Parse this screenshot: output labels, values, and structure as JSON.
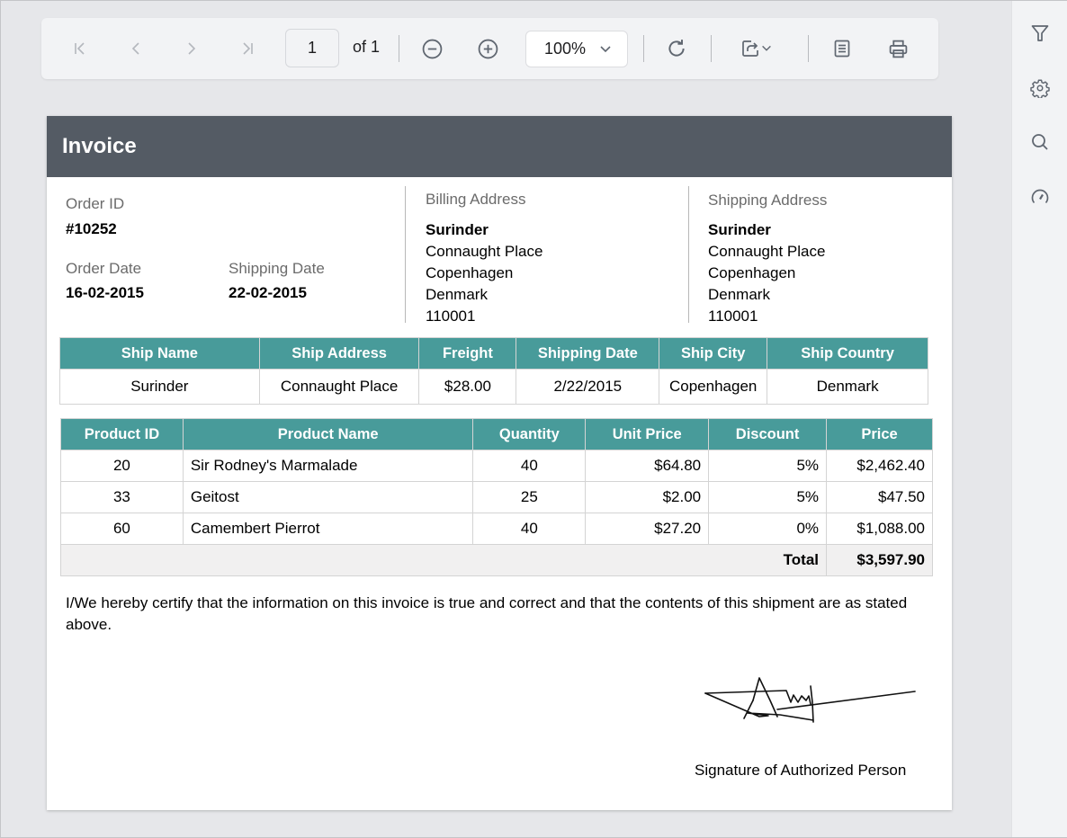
{
  "toolbar": {
    "buttons": {
      "first_page": "first-page-icon",
      "prev_page": "previous-page-icon",
      "next_page": "next-page-icon",
      "last_page": "last-page-icon",
      "zoom_out": "zoom-out-icon",
      "zoom_in": "zoom-in-icon",
      "refresh": "refresh-icon",
      "export": "export-icon",
      "parameters": "document-icon",
      "print": "print-icon"
    },
    "current_page": "1",
    "page_of": "of 1",
    "zoom_level": "100%"
  },
  "side_panel": {
    "items": [
      "filter-icon",
      "settings-icon",
      "search-icon",
      "performance-icon"
    ]
  },
  "invoice": {
    "title": "Invoice",
    "order_id_label": "Order ID",
    "order_id": "#10252",
    "order_date_label": "Order Date",
    "order_date": "16-02-2015",
    "shipping_date_label": "Shipping Date",
    "shipping_date": "22-02-2015",
    "billing": {
      "label": "Billing Address",
      "name": "Surinder",
      "street": "Connaught Place",
      "city": "Copenhagen",
      "country": "Denmark",
      "postal": "110001"
    },
    "shipping": {
      "label": "Shipping Address",
      "name": "Surinder",
      "street": "Connaught Place",
      "city": "Copenhagen",
      "country": "Denmark",
      "postal": "110001"
    },
    "ship_table": {
      "headers": [
        "Ship Name",
        "Ship Address",
        "Freight",
        "Shipping Date",
        "Ship City",
        "Ship Country"
      ],
      "row": [
        "Surinder",
        "Connaught Place",
        "$28.00",
        "2/22/2015",
        "Copenhagen",
        "Denmark"
      ]
    },
    "product_table": {
      "headers": [
        "Product ID",
        "Product Name",
        "Quantity",
        "Unit Price",
        "Discount",
        "Price"
      ],
      "rows": [
        [
          "20",
          "Sir Rodney's Marmalade",
          "40",
          "$64.80",
          "5%",
          "$2,462.40"
        ],
        [
          "33",
          "Geitost",
          "25",
          "$2.00",
          "5%",
          "$47.50"
        ],
        [
          "60",
          "Camembert Pierrot",
          "40",
          "$27.20",
          "0%",
          "$1,088.00"
        ]
      ],
      "total_label": "Total",
      "total_value": "$3,597.90"
    },
    "certification": "I/We hereby certify that the information on this invoice is true and correct and that the contents of this shipment are as stated above.",
    "signature_label": "Signature of Authorized Person"
  },
  "colors": {
    "header_bg": "#545b64",
    "table_header_bg": "#489b9a",
    "total_row_bg": "#f1f0f0",
    "viewer_bg": "#e6e7ea",
    "toolbar_bg": "#f2f3f5"
  }
}
